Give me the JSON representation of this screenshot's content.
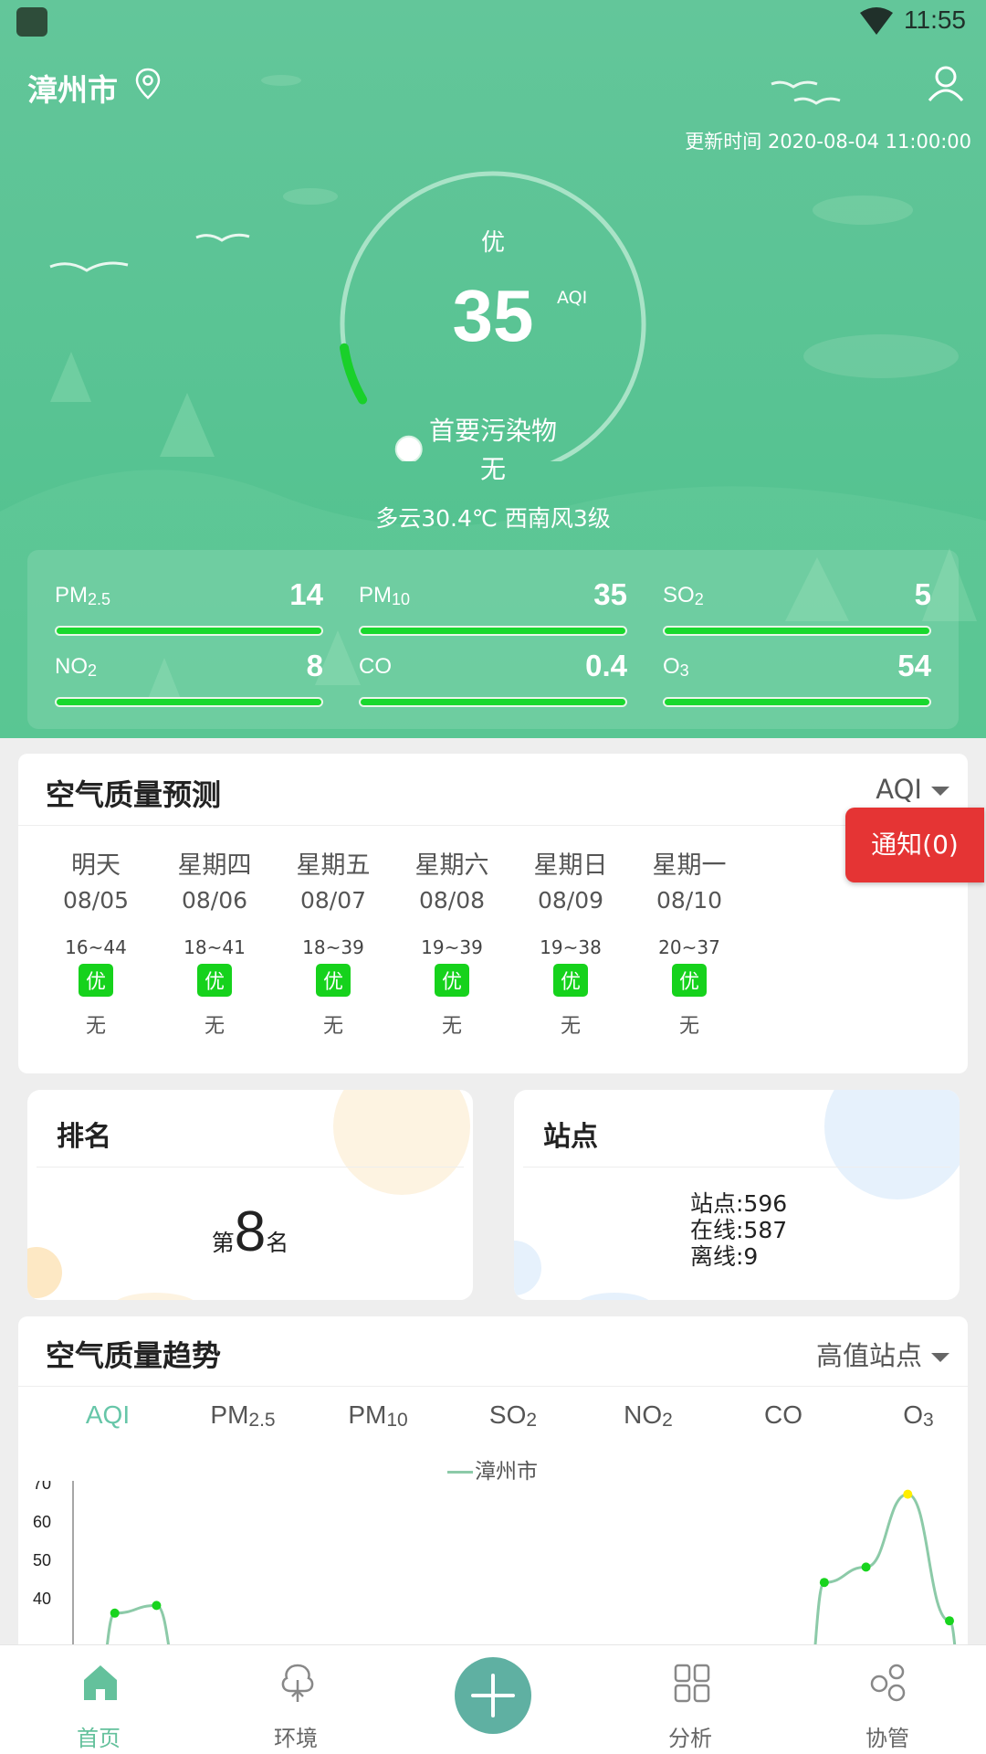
{
  "status_bar": {
    "time": "11:55"
  },
  "header": {
    "city": "漳州市",
    "update_time": "更新时间 2020-08-04 11:00:00"
  },
  "aqi": {
    "level": "优",
    "value": "35",
    "unit": "AQI",
    "primary_label": "首要污染物",
    "primary_value": "无",
    "weather": "多云30.4℃ 西南风3级",
    "gauge_fraction": 0.07
  },
  "pollutants": [
    {
      "name": "PM",
      "sub": "2.5",
      "value": "14"
    },
    {
      "name": "PM",
      "sub": "10",
      "value": "35"
    },
    {
      "name": "SO",
      "sub": "2",
      "value": "5"
    },
    {
      "name": "NO",
      "sub": "2",
      "value": "8"
    },
    {
      "name": "CO",
      "sub": "",
      "value": "0.4"
    },
    {
      "name": "O",
      "sub": "3",
      "value": "54"
    }
  ],
  "forecast": {
    "title": "空气质量预测",
    "selector": "AQI",
    "days": [
      {
        "day": "明天",
        "date": "08/05",
        "range": "16~44",
        "level": "优",
        "pollutant": "无"
      },
      {
        "day": "星期四",
        "date": "08/06",
        "range": "18~41",
        "level": "优",
        "pollutant": "无"
      },
      {
        "day": "星期五",
        "date": "08/07",
        "range": "18~39",
        "level": "优",
        "pollutant": "无"
      },
      {
        "day": "星期六",
        "date": "08/08",
        "range": "19~39",
        "level": "优",
        "pollutant": "无"
      },
      {
        "day": "星期日",
        "date": "08/09",
        "range": "19~38",
        "level": "优",
        "pollutant": "无"
      },
      {
        "day": "星期一",
        "date": "08/10",
        "range": "20~37",
        "level": "优",
        "pollutant": "无"
      }
    ]
  },
  "notice": {
    "label": "通知(0)"
  },
  "rank": {
    "title": "排名",
    "prefix": "第",
    "value": "8",
    "suffix": "名"
  },
  "sites": {
    "title": "站点",
    "total": "站点:596",
    "online": "在线:587",
    "offline": "离线:9"
  },
  "trend": {
    "title": "空气质量趋势",
    "selector": "高值站点",
    "tabs": [
      {
        "name": "AQI",
        "sub": ""
      },
      {
        "name": "PM",
        "sub": "2.5"
      },
      {
        "name": "PM",
        "sub": "10"
      },
      {
        "name": "SO",
        "sub": "2"
      },
      {
        "name": "NO",
        "sub": "2"
      },
      {
        "name": "CO",
        "sub": ""
      },
      {
        "name": "O",
        "sub": "3"
      }
    ],
    "legend": "漳州市"
  },
  "chart_data": {
    "type": "line",
    "series": [
      {
        "name": "漳州市",
        "points": [
          {
            "x": 1,
            "y": 36
          },
          {
            "x": 2,
            "y": 38
          },
          {
            "x": 18,
            "y": 44
          },
          {
            "x": 19,
            "y": 48
          },
          {
            "x": 20,
            "y": 67
          },
          {
            "x": 21,
            "y": 34
          }
        ]
      }
    ],
    "yticks": [
      "70",
      "60",
      "50",
      "40"
    ],
    "ylim": [
      30,
      70
    ],
    "highlight_point_color": "#ffee00",
    "line_color": "#8ccaa8",
    "point_color": "#18d41e"
  },
  "nav": {
    "items": [
      {
        "label": "首页",
        "icon": "home-icon"
      },
      {
        "label": "环境",
        "icon": "tree-icon"
      },
      {
        "label": "分析",
        "icon": "grid-icon"
      },
      {
        "label": "协管",
        "icon": "circles-icon"
      }
    ],
    "add_icon": "plus-icon"
  },
  "colors": {
    "header_green": "#5ac494",
    "bar_green": "#19d82e",
    "notice_red": "#e53434",
    "accent": "#64c19c"
  }
}
